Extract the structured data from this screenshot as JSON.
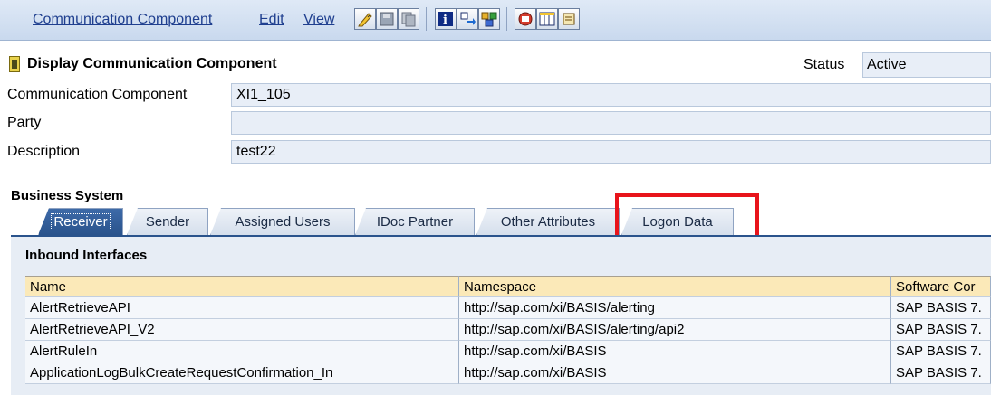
{
  "menubar": {
    "items": [
      "Communication Component",
      "Edit",
      "View"
    ],
    "toolbar_icons": [
      "edit-pencil-icon",
      "save-icon",
      "copy-icon",
      "info-icon",
      "navigate-icon",
      "compare-icon",
      "print-icon",
      "columns-icon",
      "scroll-icon"
    ]
  },
  "header": {
    "title": "Display Communication Component",
    "status_label": "Status",
    "status_value": "Active",
    "fields": [
      {
        "label": "Communication Component",
        "value": "XI1_105"
      },
      {
        "label": "Party",
        "value": ""
      },
      {
        "label": "Description",
        "value": "test22"
      }
    ]
  },
  "section": {
    "title": "Business System",
    "tabs": [
      "Receiver",
      "Sender",
      "Assigned Users",
      "IDoc Partner",
      "Other Attributes",
      "Logon Data"
    ],
    "active_tab": "Receiver",
    "highlight_color": "#e8141b"
  },
  "panel": {
    "title": "Inbound Interfaces",
    "columns": [
      "Name",
      "Namespace",
      "Software Cor"
    ],
    "rows": [
      [
        "AlertRetrieveAPI",
        "http://sap.com/xi/BASIS/alerting",
        "SAP BASIS 7."
      ],
      [
        "AlertRetrieveAPI_V2",
        "http://sap.com/xi/BASIS/alerting/api2",
        "SAP BASIS 7."
      ],
      [
        "AlertRuleIn",
        "http://sap.com/xi/BASIS",
        "SAP BASIS 7."
      ],
      [
        "ApplicationLogBulkCreateRequestConfirmation_In",
        "http://sap.com/xi/BASIS",
        "SAP BASIS 7."
      ]
    ]
  }
}
